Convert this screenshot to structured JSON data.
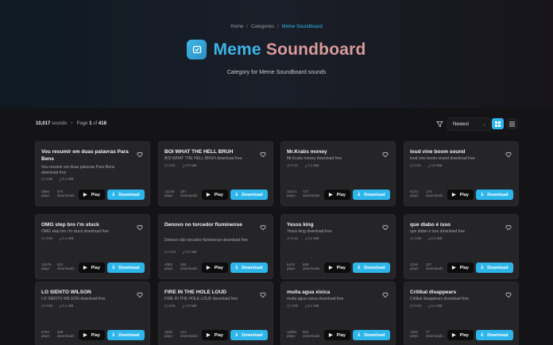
{
  "breadcrumb": {
    "home": "Home",
    "sep": "/",
    "categories": "Categories",
    "current": "Meme Soundboard"
  },
  "header": {
    "title_a": "Meme",
    "title_b": "Soundboard",
    "subtitle": "Category for Meme Soundboard sounds"
  },
  "toolbar": {
    "total": "10,017",
    "total_suffix": "sounds",
    "page_prefix": "Page",
    "page": "1",
    "of": "of",
    "pages": "418",
    "sort_value": "Newest"
  },
  "labels": {
    "play": "Play",
    "download": "Download",
    "plays": "plays",
    "downloads": "downloads"
  },
  "colors": {
    "accent": "#2eb6ea",
    "title_gradient_end": "#d89a9c",
    "card_bg": "#252528"
  },
  "cards": [
    {
      "title": "Vou resumir em duas palavras Para Bens",
      "desc": "Vou resumir em duas palavras Para Bens download free",
      "dur": "0:06",
      "size": "0.1 MB",
      "plays": "3956",
      "downloads": "674"
    },
    {
      "title": "BOI WHAT THE HELL BRUH",
      "desc": "BOI WHAT THE HELL BRUH download free",
      "dur": "0:01",
      "size": "0.0 MB",
      "plays": "12248",
      "downloads": "387"
    },
    {
      "title": "Mr.Krabs money",
      "desc": "Mr.Krabs money download free",
      "dur": "0:12",
      "size": "0.2 MB",
      "plays": "10471",
      "downloads": "727"
    },
    {
      "title": "loud vine boom sound",
      "desc": "loud vine boom sound download free",
      "dur": "0:01",
      "size": "0.0 MB",
      "plays": "6233",
      "downloads": "170"
    },
    {
      "title": "OMG step bro i'm stuck",
      "desc": "OMG step bro i'm stuck download free",
      "dur": "0:06",
      "size": "0.1 MB",
      "plays": "10476",
      "downloads": "610"
    },
    {
      "title": "Denovo no torcedor fluminense",
      "desc": "Denovo não torcedor fluminense download free",
      "dur": "0:29",
      "size": "0.2 MB",
      "plays": "4083",
      "downloads": "250"
    },
    {
      "title": "Yesss king",
      "desc": "Yesss king download free",
      "dur": "0:12",
      "size": "0.2 MB",
      "plays": "6433",
      "downloads": "689"
    },
    {
      "title": "que diabo é isso",
      "desc": "que diabo é isso download free",
      "dur": "0:06",
      "size": "0.1 MB",
      "plays": "4198",
      "downloads": "257"
    },
    {
      "title": "LO SIENTO WILSON",
      "desc": "LO SIENTO WILSON download free",
      "dur": "0:06",
      "size": "0.1 MB",
      "plays": "5784",
      "downloads": "496"
    },
    {
      "title": "FIRE IN THE HOLE LOUD",
      "desc": "FIRE IN THE HOLE LOUD download free",
      "dur": "0:01",
      "size": "0.0 MB",
      "plays": "4530",
      "downloads": "213"
    },
    {
      "title": "muita agua xixica",
      "desc": "muita agua xixica download free",
      "dur": "0:06",
      "size": "0.1 MB",
      "plays": "16891",
      "downloads": "861"
    },
    {
      "title": "Critikal disappears",
      "desc": "Critikal disappears download free",
      "dur": "0:03",
      "size": "0.1 MB",
      "plays": "1263",
      "downloads": "77"
    }
  ]
}
